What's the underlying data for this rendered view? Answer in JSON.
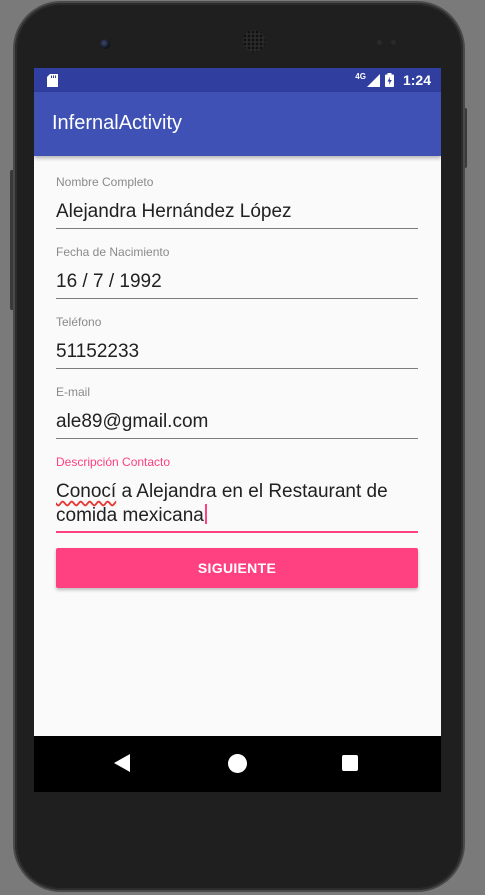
{
  "status_bar": {
    "network_label": "4G",
    "time": "1:24"
  },
  "app_bar": {
    "title": "InfernalActivity"
  },
  "form": {
    "fields": [
      {
        "label": "Nombre Completo",
        "value": "Alejandra Hernández López"
      },
      {
        "label": "Fecha de Nacimiento",
        "value": "16 / 7 / 1992"
      },
      {
        "label": "Teléfono",
        "value": "51152233"
      },
      {
        "label": "E-mail",
        "value": "ale89@gmail.com"
      }
    ],
    "description": {
      "label": "Descripción Contacto",
      "value_misspelled": "Conocí",
      "value_rest": " a Alejandra en el Restaurant de comida mexicana"
    },
    "next_button": "SIGUIENTE"
  },
  "nav_bar": {
    "icons": [
      "back-icon",
      "home-icon",
      "recent-apps-icon"
    ]
  },
  "colors": {
    "primary": "#3f51b5",
    "primary_dark": "#303f9f",
    "accent": "#ff4081"
  }
}
